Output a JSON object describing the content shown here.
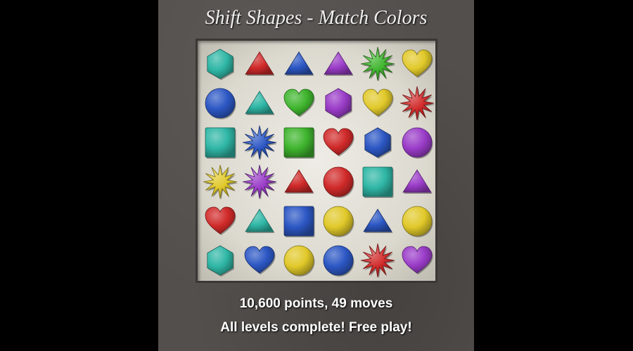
{
  "title": "Shift Shapes - Match Colors",
  "score_text": "10,600 points, 49 moves",
  "status_text": "All levels complete! Free play!",
  "colors": {
    "teal": "#2fb7a6",
    "red": "#d12a2a",
    "blue": "#2c57c4",
    "purple": "#9a3cc8",
    "green": "#3fb52e",
    "yellow": "#e1c92a"
  },
  "board": [
    [
      {
        "shape": "hexagon",
        "color": "teal"
      },
      {
        "shape": "triangle",
        "color": "red"
      },
      {
        "shape": "triangle",
        "color": "blue"
      },
      {
        "shape": "triangle",
        "color": "purple"
      },
      {
        "shape": "star",
        "color": "green"
      },
      {
        "shape": "heart",
        "color": "yellow"
      }
    ],
    [
      {
        "shape": "circle",
        "color": "blue"
      },
      {
        "shape": "triangle",
        "color": "teal"
      },
      {
        "shape": "heart",
        "color": "green"
      },
      {
        "shape": "hexagon",
        "color": "purple"
      },
      {
        "shape": "heart",
        "color": "yellow"
      },
      {
        "shape": "star",
        "color": "red"
      }
    ],
    [
      {
        "shape": "square",
        "color": "teal"
      },
      {
        "shape": "star",
        "color": "blue"
      },
      {
        "shape": "square",
        "color": "green"
      },
      {
        "shape": "heart",
        "color": "red"
      },
      {
        "shape": "hexagon",
        "color": "blue"
      },
      {
        "shape": "circle",
        "color": "purple"
      }
    ],
    [
      {
        "shape": "star",
        "color": "yellow"
      },
      {
        "shape": "star",
        "color": "purple"
      },
      {
        "shape": "triangle",
        "color": "red"
      },
      {
        "shape": "circle",
        "color": "red"
      },
      {
        "shape": "square",
        "color": "teal"
      },
      {
        "shape": "triangle",
        "color": "purple"
      }
    ],
    [
      {
        "shape": "heart",
        "color": "red"
      },
      {
        "shape": "triangle",
        "color": "teal"
      },
      {
        "shape": "square",
        "color": "blue"
      },
      {
        "shape": "circle",
        "color": "yellow"
      },
      {
        "shape": "triangle",
        "color": "blue"
      },
      {
        "shape": "circle",
        "color": "yellow"
      }
    ],
    [
      {
        "shape": "hexagon",
        "color": "teal"
      },
      {
        "shape": "heart",
        "color": "blue"
      },
      {
        "shape": "circle",
        "color": "yellow"
      },
      {
        "shape": "circle",
        "color": "blue"
      },
      {
        "shape": "star",
        "color": "red"
      },
      {
        "shape": "heart",
        "color": "purple"
      }
    ]
  ]
}
